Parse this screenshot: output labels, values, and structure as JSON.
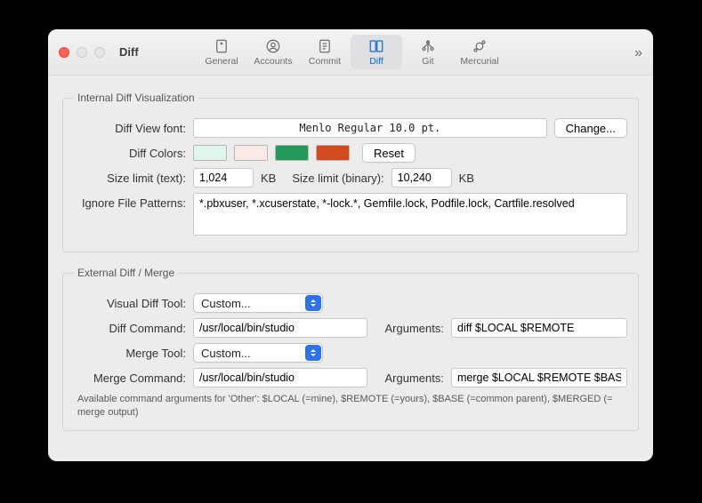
{
  "window": {
    "title": "Diff"
  },
  "toolbar": {
    "items": [
      {
        "label": "General"
      },
      {
        "label": "Accounts"
      },
      {
        "label": "Commit"
      },
      {
        "label": "Diff",
        "selected": true
      },
      {
        "label": "Git"
      },
      {
        "label": "Mercurial"
      }
    ]
  },
  "internal": {
    "legend": "Internal Diff Visualization",
    "font_label": "Diff View font:",
    "font_value": "Menlo Regular 10.0 pt.",
    "change_btn": "Change...",
    "colors_label": "Diff Colors:",
    "colors": [
      "#e1f6ea",
      "#fbe9e7",
      "#239a59",
      "#d24b1f"
    ],
    "reset_btn": "Reset",
    "size_text_label": "Size limit (text):",
    "size_text_value": "1,024",
    "size_text_unit": "KB",
    "size_bin_label": "Size limit (binary):",
    "size_bin_value": "10,240",
    "size_bin_unit": "KB",
    "ignore_label": "Ignore File Patterns:",
    "ignore_value": "*.pbxuser, *.xcuserstate, *-lock.*, Gemfile.lock, Podfile.lock, Cartfile.resolved"
  },
  "external": {
    "legend": "External Diff / Merge",
    "diff_tool_label": "Visual Diff Tool:",
    "diff_tool_value": "Custom...",
    "diff_cmd_label": "Diff Command:",
    "diff_cmd_value": "/usr/local/bin/studio",
    "diff_args_label": "Arguments:",
    "diff_args_value": "diff $LOCAL $REMOTE",
    "merge_tool_label": "Merge Tool:",
    "merge_tool_value": "Custom...",
    "merge_cmd_label": "Merge Command:",
    "merge_cmd_value": "/usr/local/bin/studio",
    "merge_args_label": "Arguments:",
    "merge_args_value": "merge $LOCAL $REMOTE $BAS",
    "hint": "Available command arguments for 'Other': $LOCAL (=mine), $REMOTE (=yours), $BASE (=common parent), $MERGED (= merge output)"
  }
}
